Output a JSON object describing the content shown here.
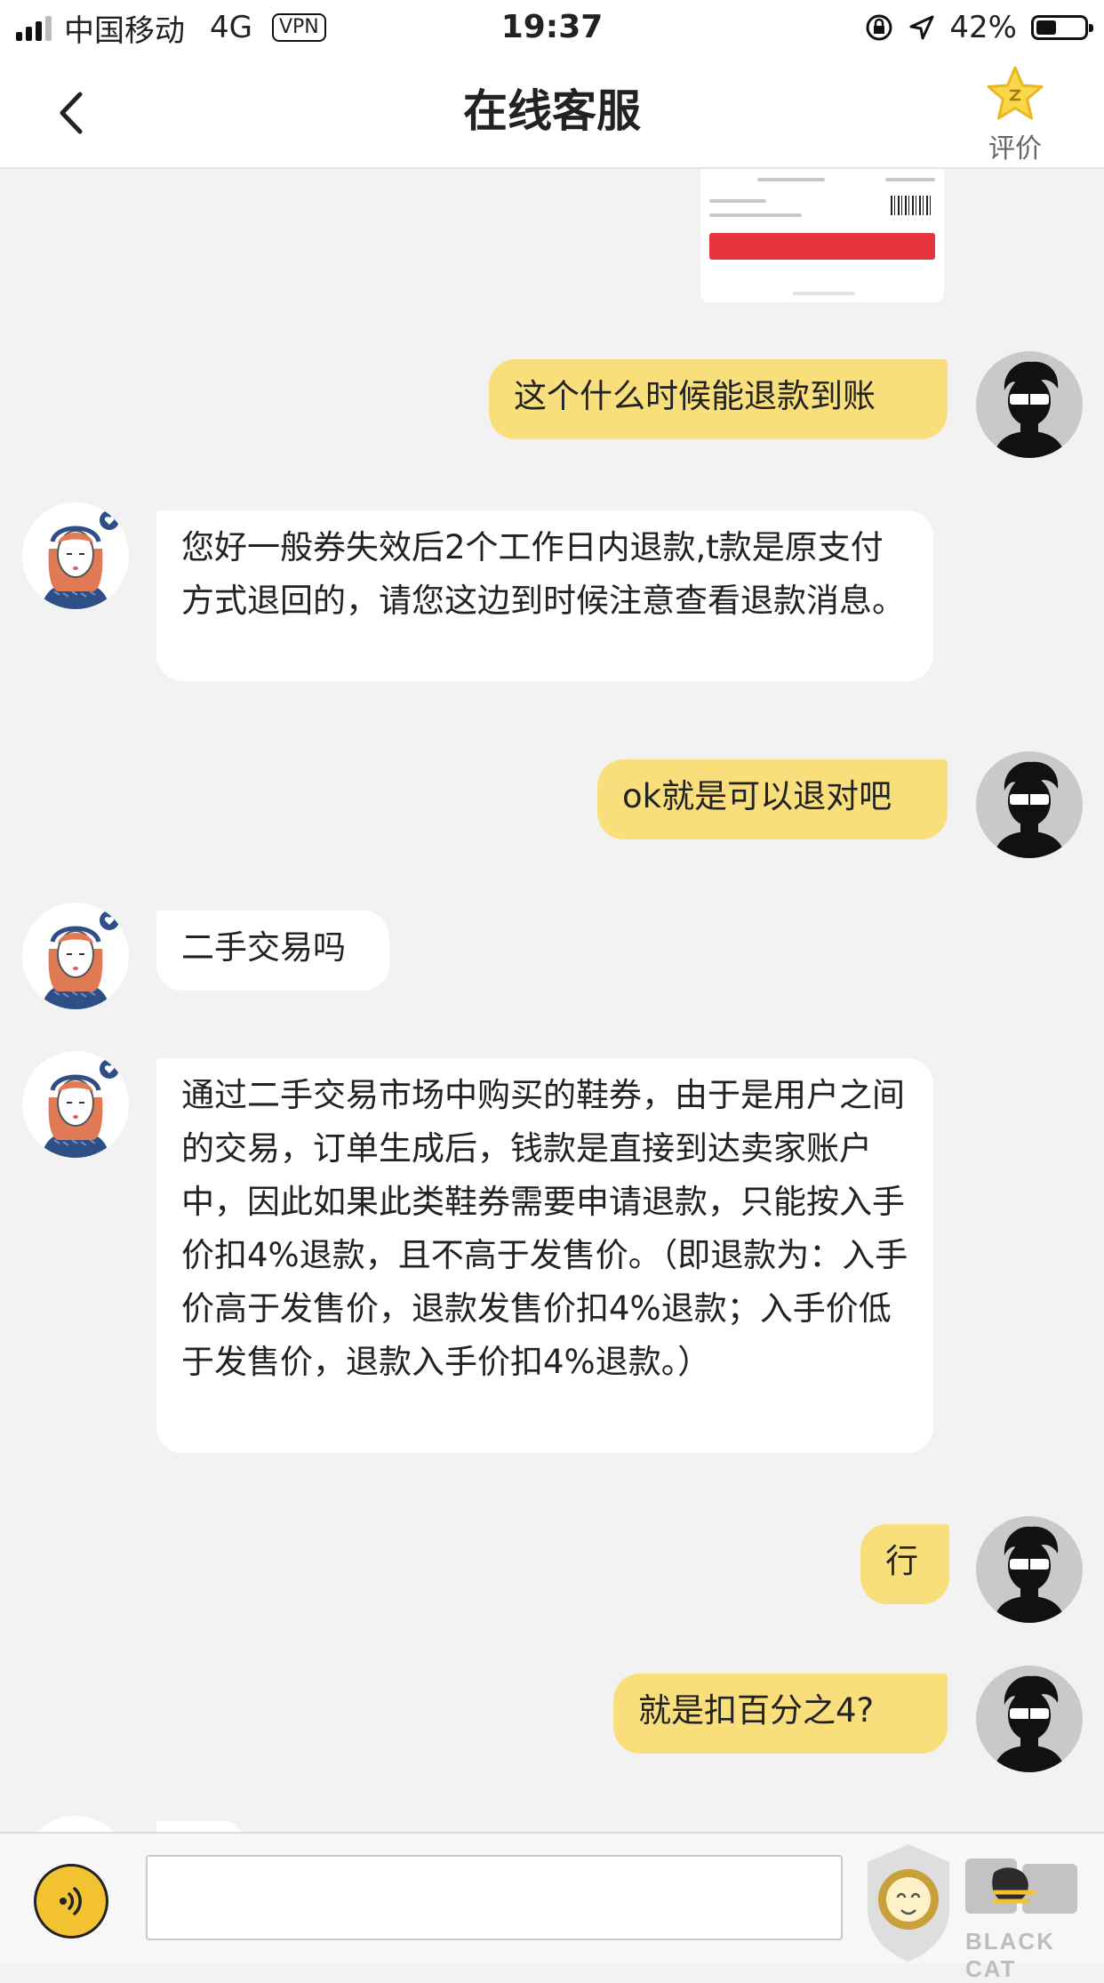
{
  "status_bar": {
    "carrier": "中国移动",
    "network": "4G",
    "vpn": "VPN",
    "time": "19:37",
    "battery_percent": "42%",
    "battery_level": 0.42
  },
  "navbar": {
    "title": "在线客服",
    "rate_label": "评价"
  },
  "messages": [
    {
      "sender": "user",
      "text": "这个什么时候能退款到账"
    },
    {
      "sender": "agent",
      "text": "您好一般券失效后2个工作日内退款,t款是原支付方式退回的，请您这边到时候注意查看退款消息。"
    },
    {
      "sender": "user",
      "text": "ok就是可以退对吧"
    },
    {
      "sender": "agent",
      "text": "二手交易吗"
    },
    {
      "sender": "agent",
      "text": "通过二手交易市场中购买的鞋券，由于是用户之间的交易，订单生成后，钱款是直接到达卖家账户中，因此如果此类鞋券需要申请退款，只能按入手价扣4%退款，且不高于发售价。（即退款为：入手价高于发售价，退款发售价扣4%退款；入手价低于发售价，退款入手价扣4%退款。）"
    },
    {
      "sender": "user",
      "text": "行"
    },
    {
      "sender": "user",
      "text": "就是扣百分之4?"
    }
  ],
  "watermark": {
    "brand": "黑猫",
    "text": "BLACK CAT"
  },
  "colors": {
    "user_bubble": "#f8df7c",
    "agent_bubble": "#ffffff",
    "accent": "#f2c230",
    "sell_button": "#e5343d"
  }
}
